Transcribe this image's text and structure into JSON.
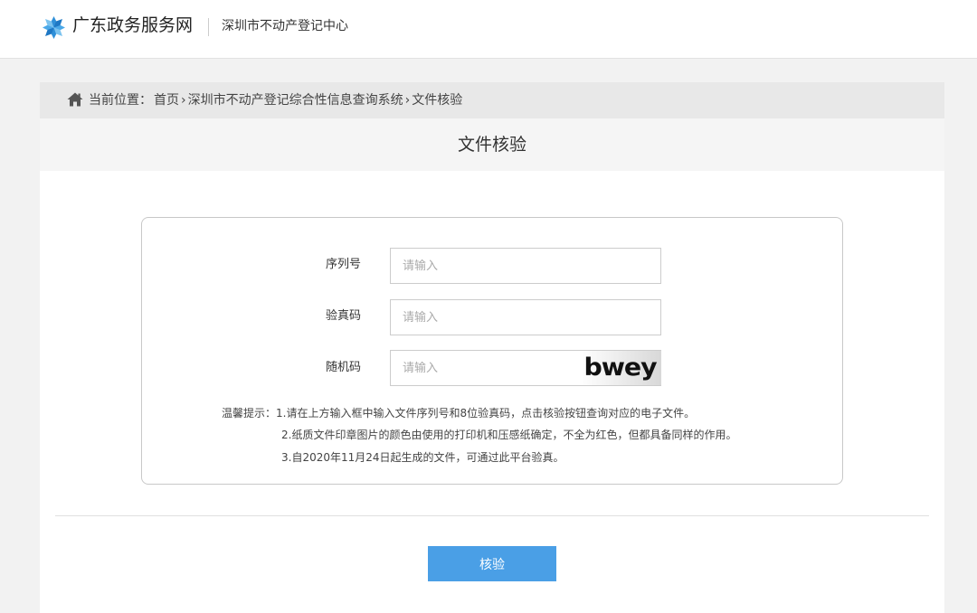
{
  "header": {
    "brand_title": "广东政务服务网",
    "brand_sub": "深圳市不动产登记中心"
  },
  "breadcrumb": {
    "prefix": "当前位置：",
    "items": [
      "首页",
      "深圳市不动产登记综合性信息查询系统",
      "文件核验"
    ],
    "separator": "›"
  },
  "panel": {
    "title": "文件核验"
  },
  "form": {
    "serial": {
      "label": "序列号",
      "placeholder": "请输入",
      "value": ""
    },
    "verify_code": {
      "label": "验真码",
      "placeholder": "请输入",
      "value": ""
    },
    "random_code": {
      "label": "随机码",
      "placeholder": "请输入",
      "value": ""
    },
    "captcha_text": "bwey"
  },
  "tips": {
    "prefix": "温馨提示：",
    "line1": "1.请在上方输入框中输入文件序列号和8位验真码，点击核验按钮查询对应的电子文件。",
    "line2": "2.纸质文件印章图片的颜色由使用的打印机和压感纸确定，不全为红色，但都具备同样的作用。",
    "line3": "3.自2020年11月24日起生成的文件，可通过此平台验真。"
  },
  "actions": {
    "verify_label": "核验"
  },
  "colors": {
    "accent": "#4a9fe6",
    "logo_blue": "#2f8fd8"
  },
  "icons": {
    "logo": "gov-service-logo-icon",
    "home": "home-icon"
  }
}
